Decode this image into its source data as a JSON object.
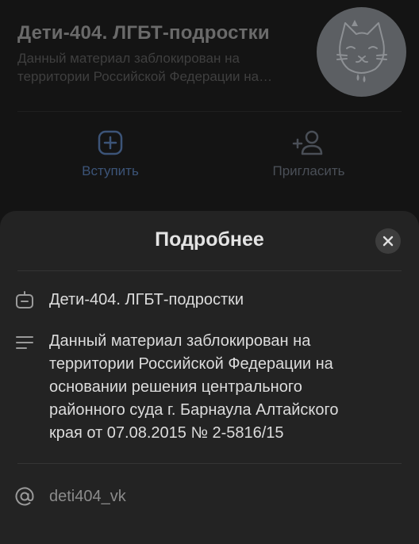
{
  "header": {
    "title": "Дети-404. ЛГБТ-подростки",
    "status": "Данный материал заблокирован на территории Российской Федерации на основании решения центрального районного суда г. Барнаула Алтайского края от 07.08.2015 № 2-5816/15",
    "avatar_icon": "cat-avatar-icon"
  },
  "actions": {
    "join_label": "Вступить",
    "invite_label": "Пригласить"
  },
  "sheet": {
    "title": "Подробнее",
    "name": "Дети-404. ЛГБТ-подростки",
    "description": "Данный материал заблокирован на территории Российской Федерации на основании решения центрального районного суда г. Барнаула Алтайского края от 07.08.2015 № 2-5816/15",
    "handle": "deti404_vk"
  },
  "colors": {
    "background": "#141414",
    "sheet": "#232323",
    "accent_blue": "#3c5478"
  }
}
